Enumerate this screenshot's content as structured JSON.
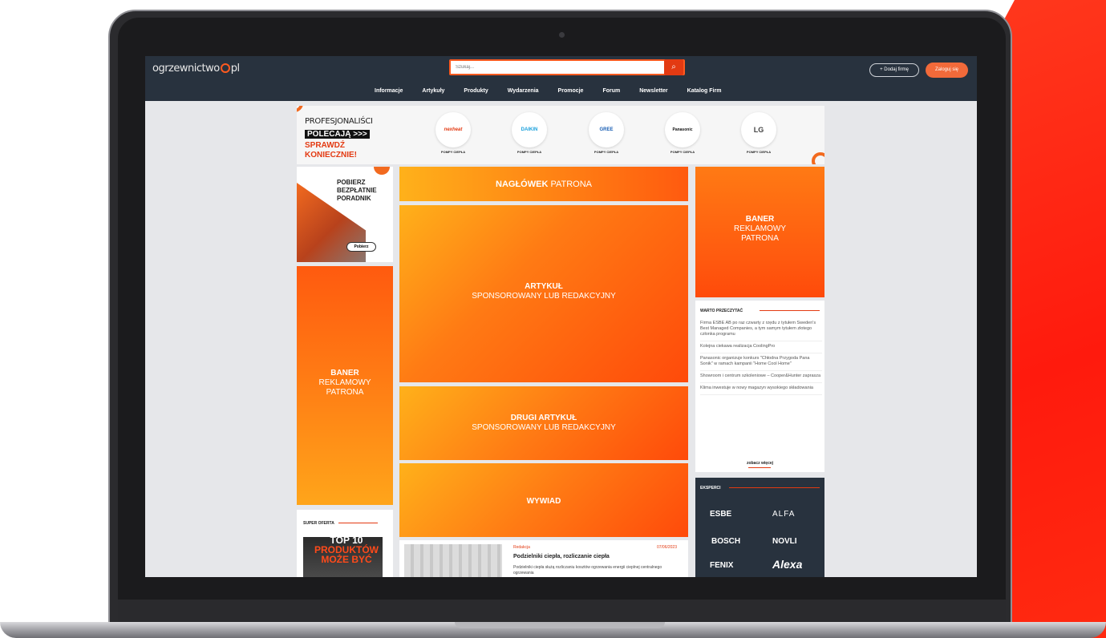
{
  "site": {
    "logo_text_a": "ogrzewnictwo",
    "logo_text_b": "pl",
    "search_placeholder": "Szukaj...",
    "search_icon": "search-icon",
    "add_company_label": "+ Dodaj firmę",
    "login_label": "Zaloguj się"
  },
  "nav": [
    "Informacje",
    "Artykuły",
    "Produkty",
    "Wydarzenia",
    "Promocje",
    "Forum",
    "Newsletter",
    "Katalog Firm"
  ],
  "partners": {
    "promo_line1": "PROFESJONALIŚCI",
    "promo_line2": "POLECAJĄ >>>",
    "promo_line3": "SPRAWDŹ",
    "promo_line4": "KONIECZNIE!",
    "brands": [
      {
        "name": "nexheat",
        "caption": "POMPY CIEPŁA"
      },
      {
        "name": "DAIKIN",
        "caption": "POMPY CIEPŁA"
      },
      {
        "name": "GREE",
        "caption": "POMPY CIEPŁA"
      },
      {
        "name": "Panasonic",
        "caption": "POMPY CIEPŁA"
      },
      {
        "name": "LG",
        "caption": "POMPY CIEPŁA"
      }
    ]
  },
  "guide": {
    "title_l1": "POBIERZ",
    "title_l2": "BEZPŁATNIE",
    "title_l3": "PORADNIK",
    "button": "Pobierz"
  },
  "banner_left": {
    "l1": "BANER",
    "l2": "REKLAMOWY",
    "l3": "PATRONA"
  },
  "super": {
    "title": "SUPER OFERTA",
    "img_l1": "TOP 10",
    "img_l2": "PRODUKTÓW",
    "img_l3": "MOŻE BYĆ"
  },
  "center": {
    "header_bold": "NAGŁÓWEK",
    "header_rest": " PATRONA",
    "article1_bold": "ARTYKUŁ",
    "article1_rest": "SPONSOROWANY LUB REDAKCYJNY",
    "article2_bold": "DRUGI ARTYKUŁ",
    "article2_rest": "SPONSOROWANY LUB REDAKCYJNY",
    "interview": "WYWIAD"
  },
  "article": {
    "category": "Redakcja",
    "date": "07/06/2023",
    "title": "Podzielniki ciepła, rozliczanie ciepła",
    "lead": "Podzielniki ciepła służą rozliczaniu kosztów ogrzewania energii cieplnej centralnego ogrzewania"
  },
  "banner_right": {
    "l1": "BANER",
    "l2": "REKLAMOWY",
    "l3": "PATRONA"
  },
  "warto": {
    "title": "WARTO PRZECZYTAĆ",
    "items": [
      "Firma ESBE AB po raz czwarty z rzędu z tytułem Sweden's Best Managed Companies, a tym samym tytułem złotego członka programu",
      "Kolejna ciekawa realizacja CoolingPro",
      "Panasonic organizuje konkurs \"Chłodna Przygoda Pana Sonik\" w ramach kampanii \"Home Cool Home\"",
      "Showroom i centrum szkoleniowe – Cooper&Hunter zaprasza",
      "Klima inwestuje w nowy magazyn wysokiego składowania"
    ],
    "more": "zobacz więcej"
  },
  "experts": {
    "title": "EKSPERCI",
    "logos": [
      "ESBE",
      "ALFA",
      "BOSCH",
      "NOVLI",
      "FENIX",
      "Alexa"
    ]
  }
}
